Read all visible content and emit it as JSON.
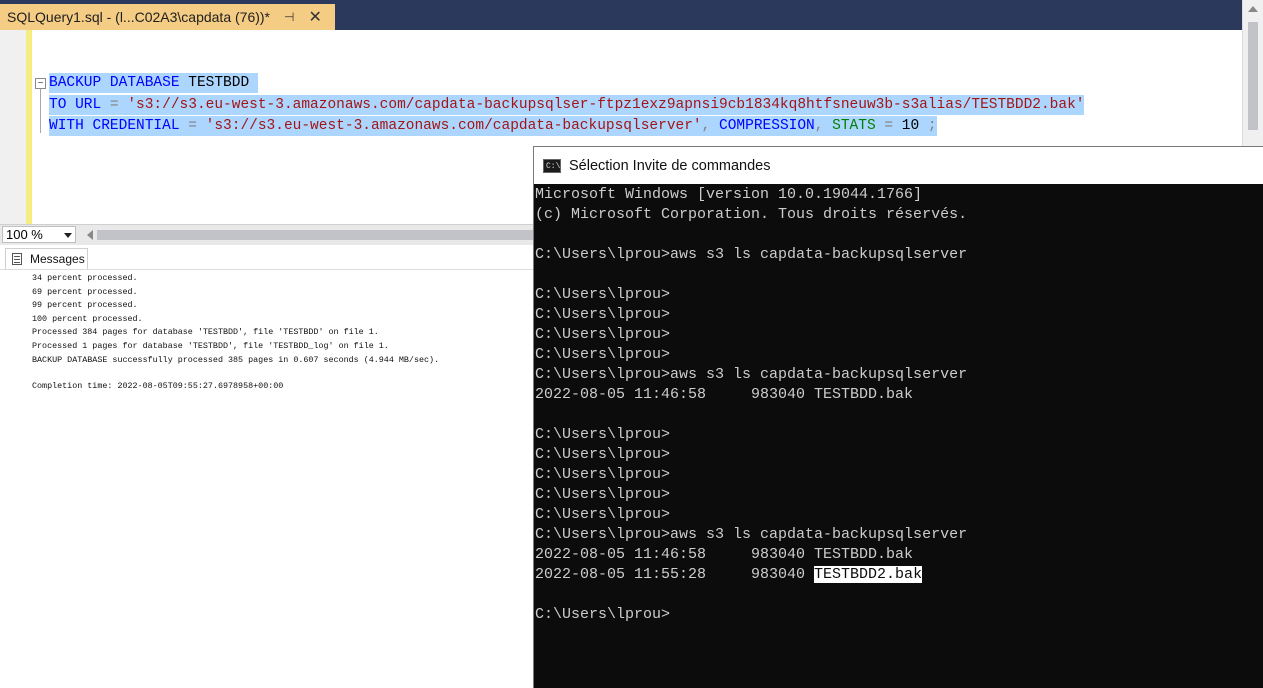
{
  "ssms": {
    "document_tab": {
      "title": "SQLQuery1.sql - (l...C02A3\\capdata (76))*",
      "pin_icon": "pin-icon",
      "close_icon": "close-icon"
    },
    "editor": {
      "outline_toggle": "−",
      "lines": [
        [
          {
            "text": "BACKUP",
            "style": "kw"
          },
          {
            "text": " ",
            "style": "plain"
          },
          {
            "text": "DATABASE",
            "style": "kw"
          },
          {
            "text": " TESTBDD ",
            "style": "plain"
          }
        ],
        [
          {
            "text": "TO",
            "style": "kw"
          },
          {
            "text": " ",
            "style": "plain"
          },
          {
            "text": "URL",
            "style": "kw"
          },
          {
            "text": " ",
            "style": "plain"
          },
          {
            "text": "=",
            "style": "gry"
          },
          {
            "text": " ",
            "style": "plain"
          },
          {
            "text": "'s3://s3.eu-west-3.amazonaws.com/capdata-backupsqlser-ftpz1exz9apnsi9cb1834kq8htfsneuw3b-s3alias/TESTBDD2.bak'",
            "style": "str"
          }
        ],
        [
          {
            "text": "WITH",
            "style": "kw"
          },
          {
            "text": " ",
            "style": "plain"
          },
          {
            "text": "CREDENTIAL",
            "style": "kw"
          },
          {
            "text": " ",
            "style": "plain"
          },
          {
            "text": "=",
            "style": "gry"
          },
          {
            "text": " ",
            "style": "plain"
          },
          {
            "text": "'s3://s3.eu-west-3.amazonaws.com/capdata-backupsqlserver'",
            "style": "str"
          },
          {
            "text": ",",
            "style": "gry"
          },
          {
            "text": " ",
            "style": "plain"
          },
          {
            "text": "COMPRESSION",
            "style": "kw"
          },
          {
            "text": ",",
            "style": "gry"
          },
          {
            "text": " ",
            "style": "plain"
          },
          {
            "text": "STATS",
            "style": "grn"
          },
          {
            "text": " ",
            "style": "plain"
          },
          {
            "text": "=",
            "style": "gry"
          },
          {
            "text": " 10 ",
            "style": "plain"
          },
          {
            "text": ";",
            "style": "gry"
          }
        ]
      ]
    },
    "zoom": {
      "value": "100 %"
    },
    "results": {
      "tab_label": "Messages",
      "messages": [
        "34 percent processed.",
        "69 percent processed.",
        "99 percent processed.",
        "100 percent processed.",
        "Processed 384 pages for database 'TESTBDD', file 'TESTBDD' on file 1.",
        "Processed 1 pages for database 'TESTBDD', file 'TESTBDD_log' on file 1.",
        "BACKUP DATABASE successfully processed 385 pages in 0.607 seconds (4.944 MB/sec)."
      ],
      "completion": "Completion time: 2022-08-05T09:55:27.6978958+00:00"
    }
  },
  "cmd": {
    "title": "Sélection Invite de commandes",
    "icon_text": "C:\\",
    "lines": [
      "Microsoft Windows [version 10.0.19044.1766]",
      "(c) Microsoft Corporation. Tous droits réservés.",
      "",
      "C:\\Users\\lprou>aws s3 ls capdata-backupsqlserver",
      "",
      "C:\\Users\\lprou>",
      "C:\\Users\\lprou>",
      "C:\\Users\\lprou>",
      "C:\\Users\\lprou>",
      "C:\\Users\\lprou>aws s3 ls capdata-backupsqlserver",
      "2022-08-05 11:46:58     983040 TESTBDD.bak",
      "",
      "C:\\Users\\lprou>",
      "C:\\Users\\lprou>",
      "C:\\Users\\lprou>",
      "C:\\Users\\lprou>",
      "C:\\Users\\lprou>",
      "C:\\Users\\lprou>aws s3 ls capdata-backupsqlserver",
      "2022-08-05 11:46:58     983040 TESTBDD.bak",
      "",
      "",
      "C:\\Users\\lprou>"
    ],
    "selected_line": {
      "prefix": "2022-08-05 11:55:28     983040 ",
      "selected": "TESTBDD2.bak"
    }
  },
  "colors": {
    "tab_active": "#f5cc84",
    "tabstrip": "#2b3a5c",
    "selection": "#add6ff",
    "keyword": "#0000ff",
    "string": "#a31515",
    "console_bg": "#0c0c0c",
    "console_text": "#cccccc"
  }
}
